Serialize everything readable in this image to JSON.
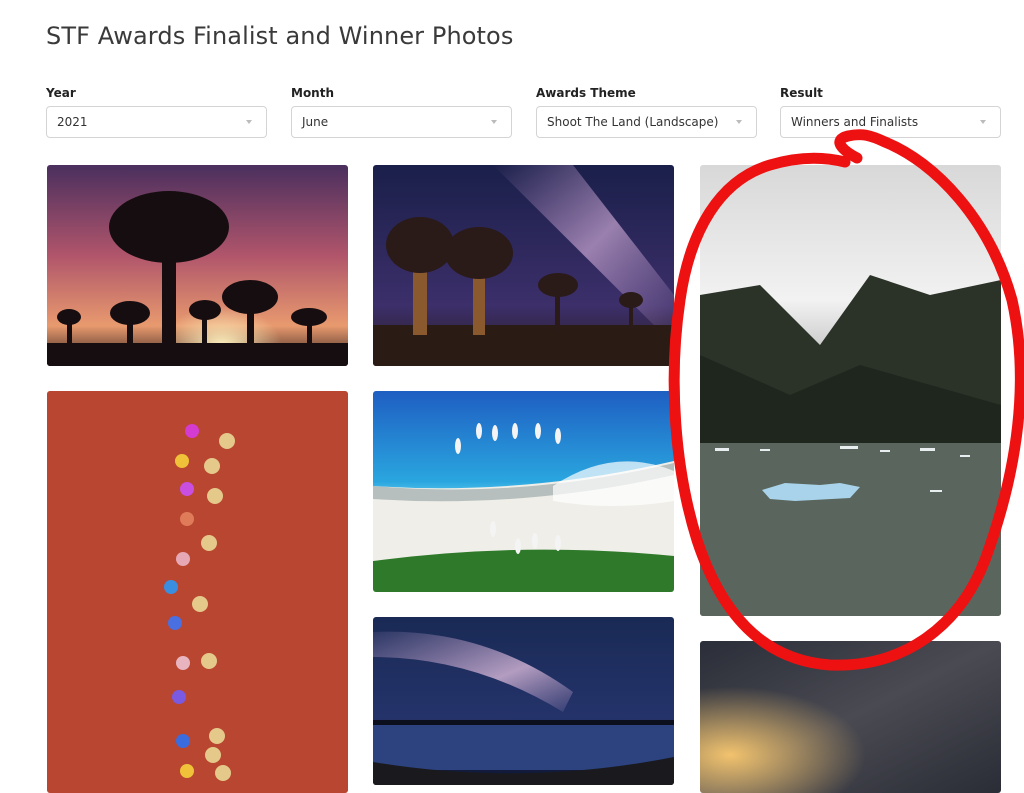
{
  "page": {
    "title": "STF Awards Finalist and Winner Photos"
  },
  "filters": [
    {
      "label": "Year",
      "value": "2021"
    },
    {
      "label": "Month",
      "value": "June"
    },
    {
      "label": "Awards Theme",
      "value": "Shoot The Land (Landscape)"
    },
    {
      "label": "Result",
      "value": "Winners and Finalists"
    }
  ],
  "colors": {
    "annotation": "#ee1111",
    "border": "#d4d4d4"
  },
  "icons": {
    "dropdown": "chevron-down-icon"
  }
}
